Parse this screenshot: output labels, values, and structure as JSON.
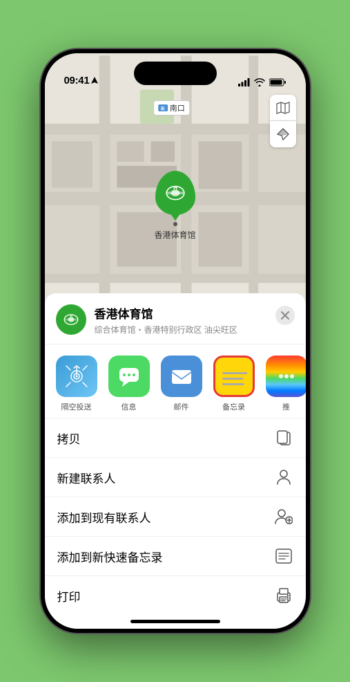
{
  "status_bar": {
    "time": "09:41",
    "location_arrow": true
  },
  "map": {
    "label_text": "南口",
    "label_prefix": "出口",
    "marker_name": "香港体育馆",
    "controls": {
      "map_icon": "map-icon",
      "location_icon": "location-arrow-icon"
    }
  },
  "location_header": {
    "name": "香港体育馆",
    "description": "综合体育馆・香港特别行政区 油尖旺区",
    "close_label": "×"
  },
  "share_row": {
    "items": [
      {
        "id": "airdrop",
        "label": "隔空投送",
        "icon_type": "airdrop"
      },
      {
        "id": "messages",
        "label": "信息",
        "icon_type": "messages"
      },
      {
        "id": "mail",
        "label": "邮件",
        "icon_type": "mail"
      },
      {
        "id": "notes",
        "label": "备忘录",
        "icon_type": "notes"
      },
      {
        "id": "more",
        "label": "推",
        "icon_type": "more"
      }
    ]
  },
  "action_rows": [
    {
      "id": "copy",
      "label": "拷贝",
      "icon": "copy-icon"
    },
    {
      "id": "new-contact",
      "label": "新建联系人",
      "icon": "person-icon"
    },
    {
      "id": "add-contact",
      "label": "添加到现有联系人",
      "icon": "add-person-icon"
    },
    {
      "id": "quick-notes",
      "label": "添加到新快速备忘录",
      "icon": "quick-note-icon"
    },
    {
      "id": "print",
      "label": "打印",
      "icon": "print-icon"
    }
  ]
}
